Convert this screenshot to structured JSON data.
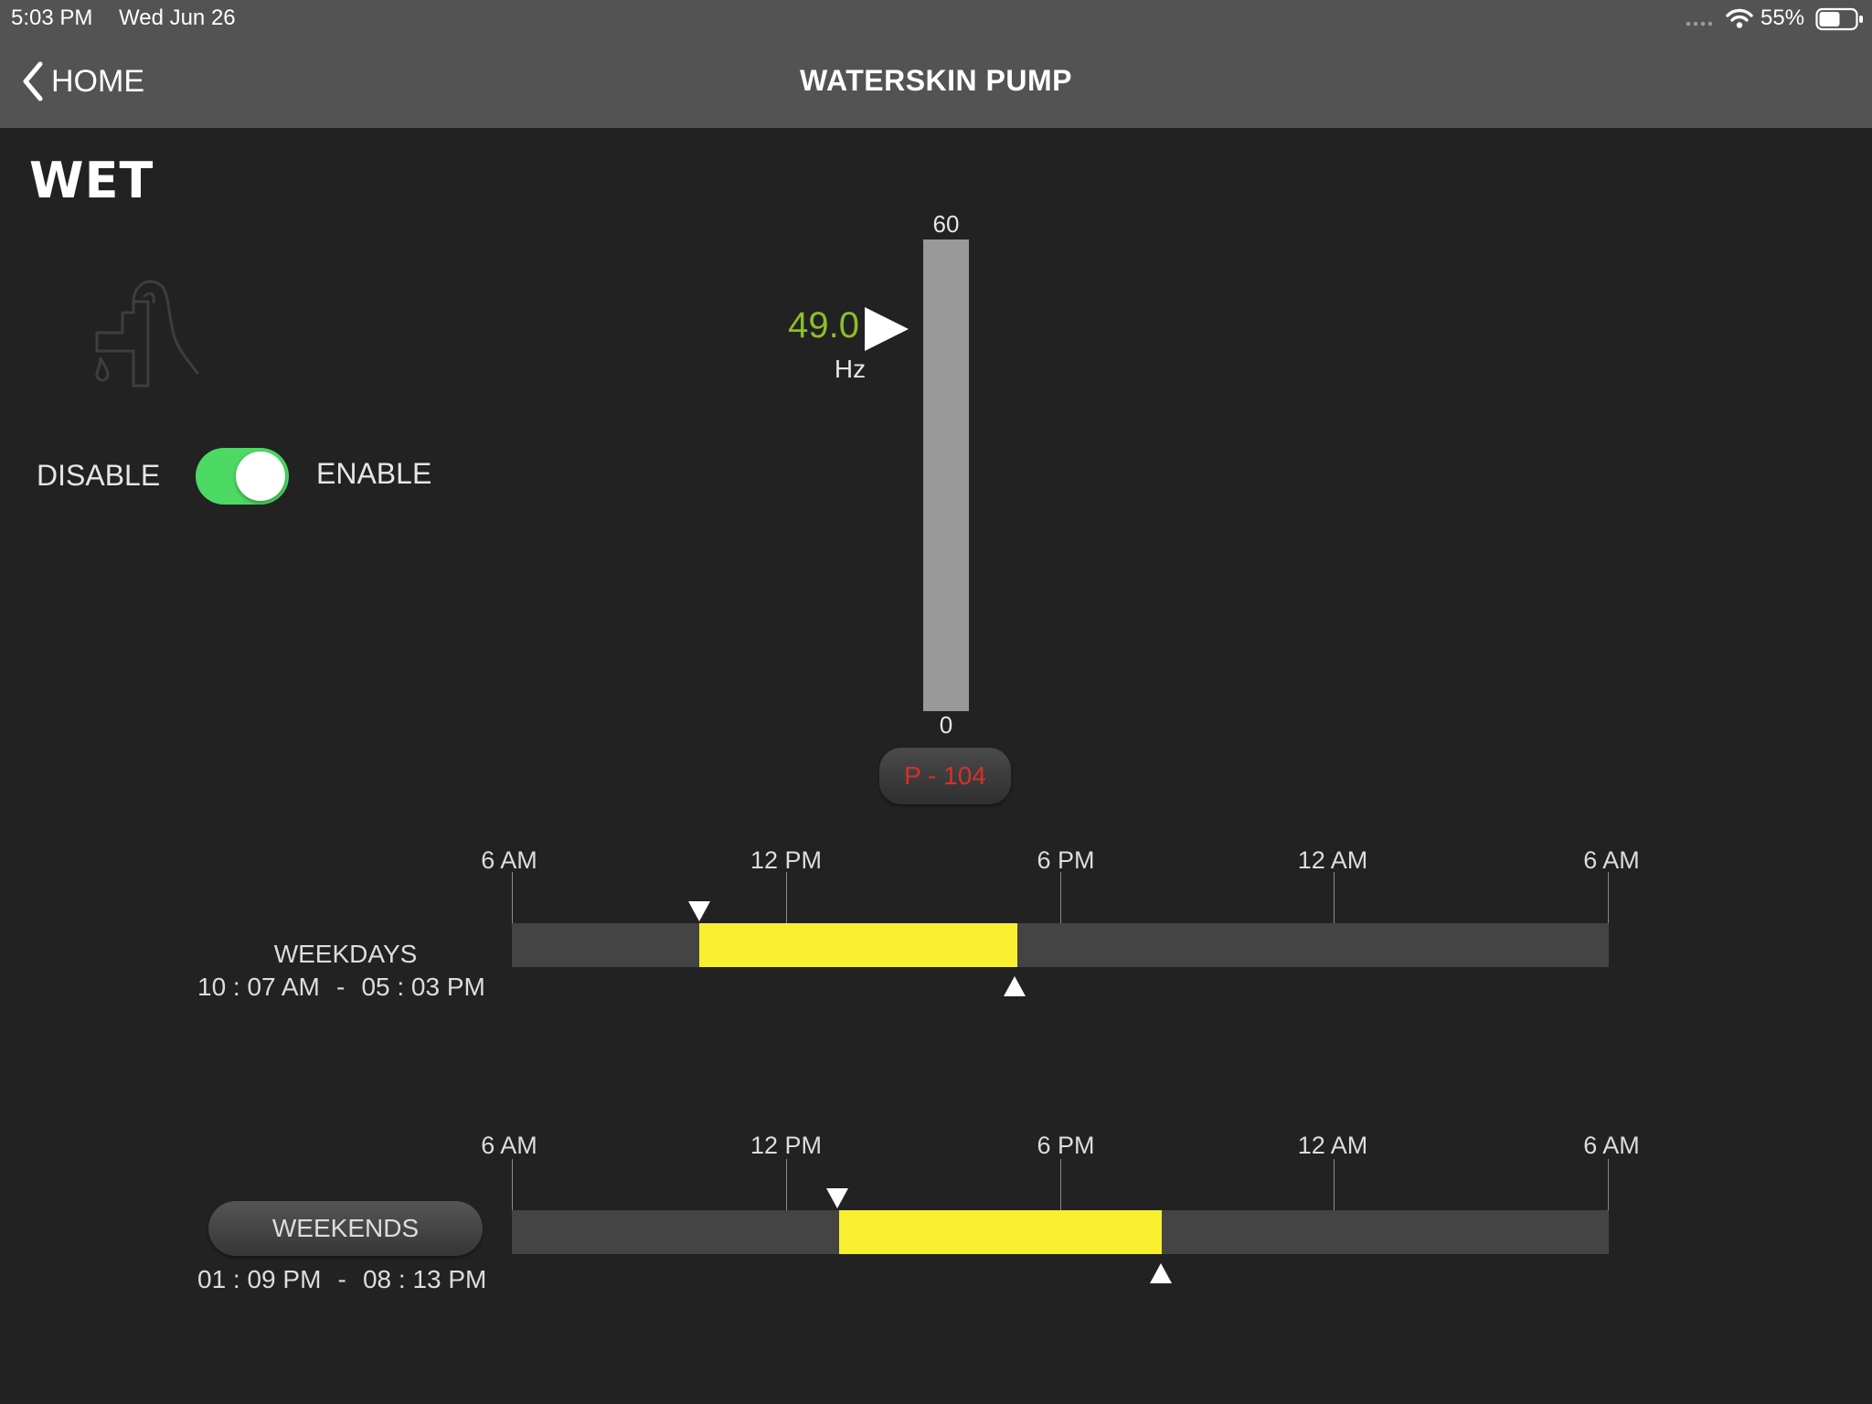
{
  "status_bar": {
    "time": "5:03 PM",
    "date": "Wed Jun 26",
    "battery": "55%"
  },
  "nav": {
    "back_label": "HOME",
    "title": "WATERSKIN PUMP"
  },
  "zone": {
    "title": "WET",
    "icon": "water-pump-icon"
  },
  "toggle": {
    "off_label": "DISABLE",
    "on_label": "ENABLE",
    "enabled": true,
    "color": "#4cd964"
  },
  "gauge": {
    "max_label": "60",
    "min_label": "0",
    "value": "49.0",
    "unit": "Hz",
    "value_color": "#8cbe2b",
    "device": "P - 104",
    "device_color": "#d6302b"
  },
  "timeline": {
    "tick_labels": [
      "6 AM",
      "12 PM",
      "6 PM",
      "12 AM",
      "6 AM"
    ]
  },
  "schedules": {
    "weekdays": {
      "label": "WEEKDAYS",
      "start": "10 : 07 AM",
      "separator": "-",
      "end": "05 : 03 PM"
    },
    "weekends": {
      "label": "WEEKENDS",
      "start": "01 : 09 PM",
      "separator": "-",
      "end": "08 : 13 PM"
    }
  },
  "colors": {
    "active_range": "#f8ef2f",
    "header_bg": "#535353",
    "page_bg": "#222222"
  }
}
